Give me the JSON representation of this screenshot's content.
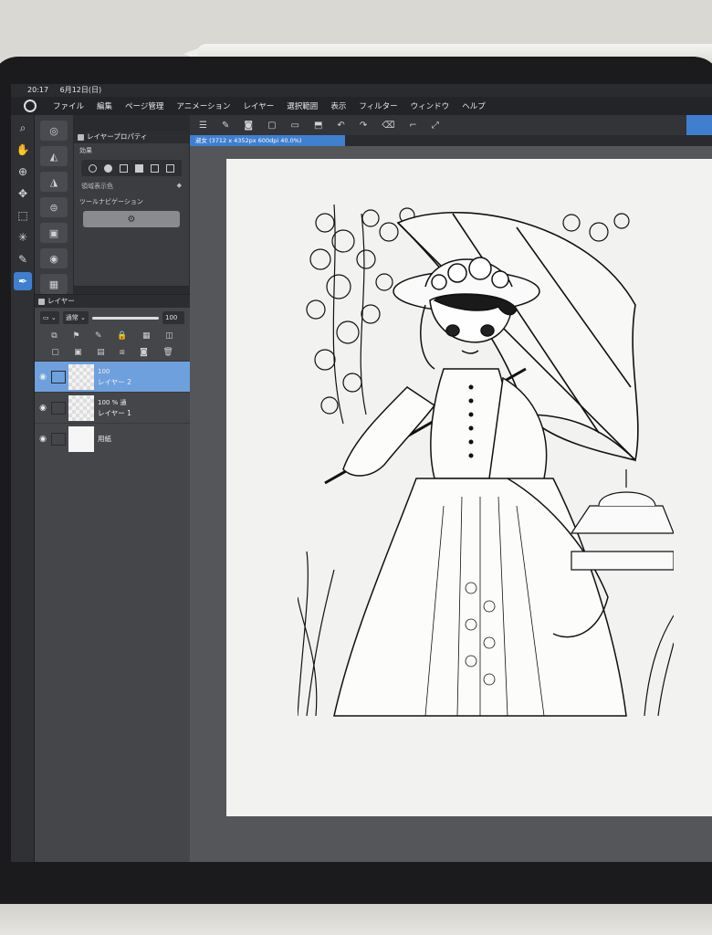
{
  "status": {
    "time": "20:17",
    "date": "6月12日(日)"
  },
  "menu": {
    "items": [
      "ファイル",
      "編集",
      "ページ管理",
      "アニメーション",
      "レイヤー",
      "選択範囲",
      "表示",
      "フィルター",
      "ウィンドウ",
      "ヘルプ"
    ]
  },
  "layer_property": {
    "title": "レイヤープロパティ",
    "effect_label": "効果",
    "display_color_label": "領域表示色",
    "tool_nav_label": "ツールナビゲーション"
  },
  "layer_panel": {
    "title": "レイヤー",
    "blend_mode": "通常",
    "opacity": "100",
    "layers": [
      {
        "name": "レイヤー 2",
        "opacity": "100",
        "selected": true
      },
      {
        "name": "レイヤー 1",
        "opacity": "100 % 通",
        "selected": false
      },
      {
        "name": "用紙",
        "opacity": "",
        "selected": false
      }
    ]
  },
  "document": {
    "tab_label": "淑女 (3712 x 4352px 600dpi 40.0%)"
  },
  "colors": {
    "accent": "#3f7fd0",
    "selected_layer": "#6ea0dd",
    "panel": "#45464a"
  }
}
